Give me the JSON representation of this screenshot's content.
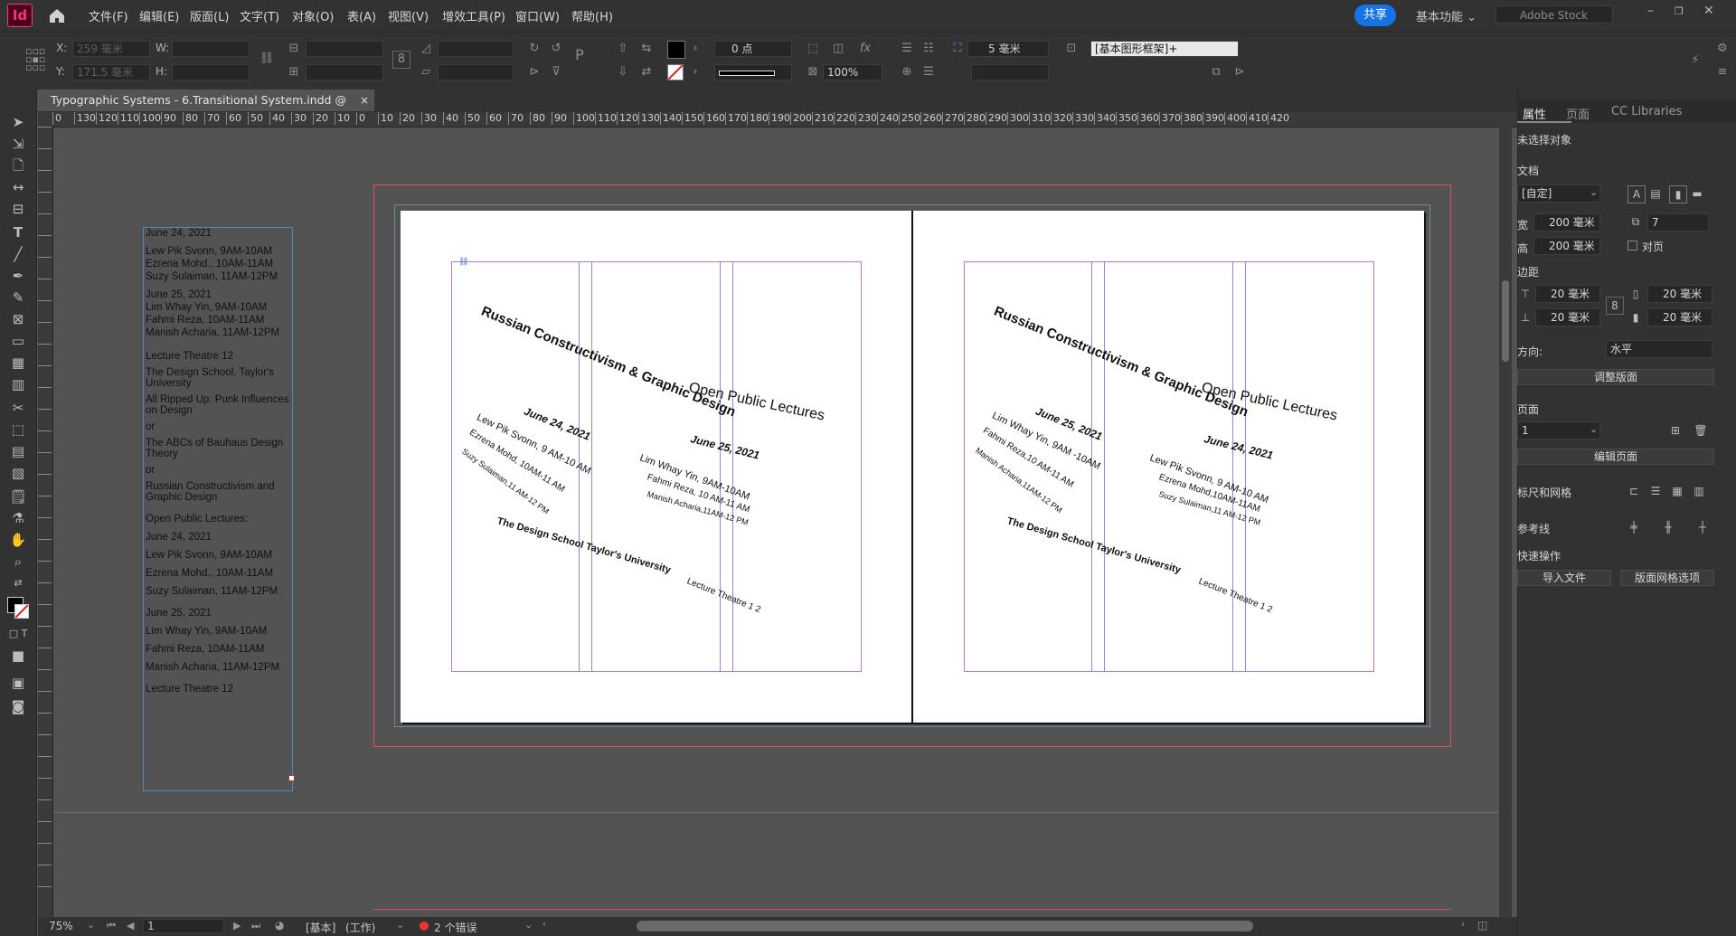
{
  "app": {
    "logo": "Id",
    "menus": [
      "文件(F)",
      "编辑(E)",
      "版面(L)",
      "文字(T)",
      "对象(O)",
      "表(A)",
      "视图(V)",
      "增效工具(P)",
      "窗口(W)",
      "帮助(H)"
    ],
    "share_label": "共享",
    "workspace_label": "基本功能",
    "stock_placeholder": "Adobe Stock"
  },
  "control": {
    "x_label": "X:",
    "y_label": "Y:",
    "w_label": "W:",
    "h_label": "H:",
    "x_value": "259 毫米",
    "y_value": "171.5 毫米",
    "stroke_weight": "0 点",
    "opacity": "100%",
    "gap_value": "5 毫米",
    "object_style": "[基本图形框架]+"
  },
  "document": {
    "tab_title": "Typographic Systems - 6.Transitional System.indd @ 75%",
    "close_glyph": "×"
  },
  "ruler": {
    "h_ticks": [
      "0",
      "130",
      "120",
      "110",
      "100",
      "90",
      "80",
      "70",
      "60",
      "50",
      "40",
      "30",
      "20",
      "10",
      "0",
      "10",
      "20",
      "30",
      "40",
      "50",
      "60",
      "70",
      "80",
      "90",
      "100",
      "110",
      "120",
      "130",
      "140",
      "150",
      "160",
      "170",
      "180",
      "190",
      "200",
      "210",
      "220",
      "230",
      "240",
      "250",
      "260",
      "270",
      "280",
      "290",
      "300",
      "310",
      "320",
      "330",
      "340",
      "350",
      "360",
      "370",
      "380",
      "390",
      "400",
      "410",
      "420"
    ]
  },
  "text_frame": {
    "lines": [
      "June 24, 2021",
      "Lew Pik Svonn, 9AM-10AM",
      "Ezrena Mohd., 10AM-11AM",
      "Suzy Sulaiman, 11AM-12PM",
      "June 25, 2021",
      "Lim Whay Yin, 9AM-10AM",
      "Fahmi Reza, 10AM-11AM",
      "Manish Acharia, 11AM-12PM",
      "Lecture Theatre 12",
      "The Design School, Taylor's",
      "University",
      "All Ripped Up: Punk Influences",
      "on Design",
      "or",
      "The ABCs of Bauhaus Design",
      "Theory",
      "or",
      "Russian Constructivism and",
      "Graphic Design",
      "Open Public Lectures:",
      "June 24, 2021",
      "Lew Pik Svonn, 9AM-10AM",
      "Ezrena Mohd., 10AM-11AM",
      "Suzy Sulaiman, 11AM-12PM",
      "June 25, 2021",
      "Lim Whay Yin, 9AM-10AM",
      "Fahmi Reza, 10AM-11AM",
      "Manish Acharia, 11AM-12PM",
      "Lecture Theatre 12"
    ]
  },
  "left_page": {
    "title": "Russian Constructivism & Graphic Design",
    "subtitle": "Open Public Lectures",
    "date1": "June 24,   2021",
    "d1_l1": "Lew Pik Svonn, 9 AM-10 AM",
    "d1_l2": "Ezrena Mohd, 10AM-11 AM",
    "d1_l3": "Suzy Sulaiman,11 AM-12 PM",
    "date2": "June 25,   2021",
    "d2_l1": "Lim Whay Yin, 9AM-10AM",
    "d2_l2": "Fahmi Reza, 10 AM-11 AM",
    "d2_l3": "Manish Acharia,11AM-12 PM",
    "school": "The Design School Taylor's University",
    "venue": "Lecture Theatre 1 2"
  },
  "right_page": {
    "title": "Russian Constructivism & Graphic Design",
    "subtitle": "Open Public Lectures",
    "date1": "June 25,   2021",
    "d1_l1": "Lim Whay Yin, 9AM -10AM",
    "d1_l2": "Fahmi Reza,10 AM-11 AM",
    "d1_l3": "Manish Acharia,11AM-12 PM",
    "date2": "June 24,   2021",
    "d2_l1": "Lew Pik Svonn, 9 AM-10 AM",
    "d2_l2": "Ezrena Mohd,10AM-11AM",
    "d2_l3": "Suzy Sulaiman,11 AM-12 PM",
    "school": "The Design School Taylor's University",
    "venue": "Lecture Theatre 1 2"
  },
  "status": {
    "zoom": "75%",
    "page": "1",
    "master": "[基本]",
    "mode": "(工作)",
    "errors": "2 个错误"
  },
  "panel": {
    "tabs": [
      "属性",
      "页面",
      "CC Libraries"
    ],
    "no_selection": "未选择对象",
    "doc_heading": "文档",
    "preset": "[自定]",
    "width_label": "宽",
    "width_value": "200 毫米",
    "height_label": "高",
    "height_value": "200 毫米",
    "pages_count": "7",
    "facing_label": "对页",
    "margins_heading": "边距",
    "margin_top": "20 毫米",
    "margin_bottom": "20 毫米",
    "margin_inside": "20 毫米",
    "margin_outside": "20 毫米",
    "orientation_label": "方向:",
    "orientation_value": "水平",
    "adjust_layout": "调整版面",
    "page_heading": "页面",
    "page_value": "1",
    "edit_page": "编辑页面",
    "rulers_grids": "标尺和网格",
    "guides": "参考线",
    "quick_actions": "快速操作",
    "import_file": "导入文件",
    "layout_grid": "版面网格选项"
  }
}
